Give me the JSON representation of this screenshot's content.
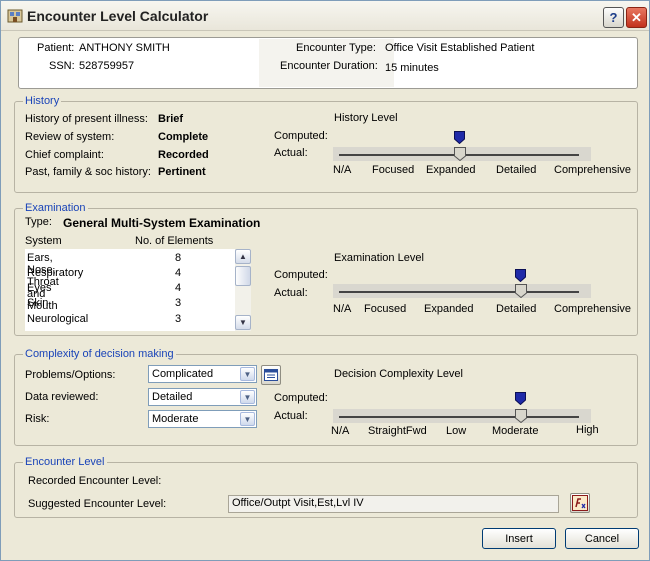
{
  "window": {
    "title": "Encounter Level Calculator",
    "help_label": "?",
    "close_label": "✕"
  },
  "patient": {
    "patient_label": "Patient:",
    "patient_value": "ANTHONY SMITH",
    "ssn_label": "SSN:",
    "ssn_value": "528759957",
    "encounter_type_label": "Encounter Type:",
    "encounter_type_value": "Office Visit Established Patient",
    "duration_label": "Encounter Duration:",
    "duration_value": "15 minutes"
  },
  "history": {
    "legend": "History",
    "rows": [
      {
        "label": "History of present illness:",
        "value": "Brief"
      },
      {
        "label": "Review of system:",
        "value": "Complete"
      },
      {
        "label": "Chief complaint:",
        "value": "Recorded"
      },
      {
        "label": "Past, family & soc history:",
        "value": "Pertinent"
      }
    ],
    "level_title": "History Level",
    "computed_label": "Computed:",
    "actual_label": "Actual:",
    "scale": [
      "N/A",
      "Focused",
      "Expanded",
      "Detailed",
      "Comprehensive"
    ],
    "computed_level": "Expanded",
    "actual_level": "Expanded"
  },
  "examination": {
    "legend": "Examination",
    "type_label": "Type:",
    "type_value": "General Multi-System Examination",
    "col_system": "System",
    "col_elements": "No. of Elements",
    "systems": [
      {
        "name": "Ears, Nose, Throat and Mouth",
        "count": "8"
      },
      {
        "name": "Respiratory",
        "count": "4"
      },
      {
        "name": "Eyes",
        "count": "4"
      },
      {
        "name": "Skin",
        "count": "3"
      },
      {
        "name": "Neurological",
        "count": "3"
      }
    ],
    "level_title": "Examination Level",
    "computed_label": "Computed:",
    "actual_label": "Actual:",
    "scale": [
      "N/A",
      "Focused",
      "Expanded",
      "Detailed",
      "Comprehensive"
    ],
    "computed_level": "Detailed",
    "actual_level": "Detailed"
  },
  "decision": {
    "legend": "Complexity of decision making",
    "problems_label": "Problems/Options:",
    "problems_value": "Complicated",
    "data_label": "Data reviewed:",
    "data_value": "Detailed",
    "risk_label": "Risk:",
    "risk_value": "Moderate",
    "level_title": "Decision Complexity Level",
    "computed_label": "Computed:",
    "actual_label": "Actual:",
    "scale": [
      "N/A",
      "StraightFwd",
      "Low",
      "Moderate",
      "High"
    ],
    "computed_level": "Moderate",
    "actual_level": "Moderate"
  },
  "encounter": {
    "legend": "Encounter Level",
    "recorded_label": "Recorded Encounter Level:",
    "recorded_value": "",
    "suggested_label": "Suggested Encounter Level:",
    "suggested_value": "Office/Outpt Visit,Est,Lvl IV"
  },
  "buttons": {
    "insert": "Insert",
    "cancel": "Cancel"
  },
  "icons": [
    "window-app-icon",
    "list-view-icon",
    "formula-icon",
    "computed-marker-icon",
    "slider-thumb-icon"
  ],
  "colors": {
    "legend_blue": "#1a44b8",
    "marker_blue": "#1f2aa8",
    "close_red": "#c2311c"
  }
}
